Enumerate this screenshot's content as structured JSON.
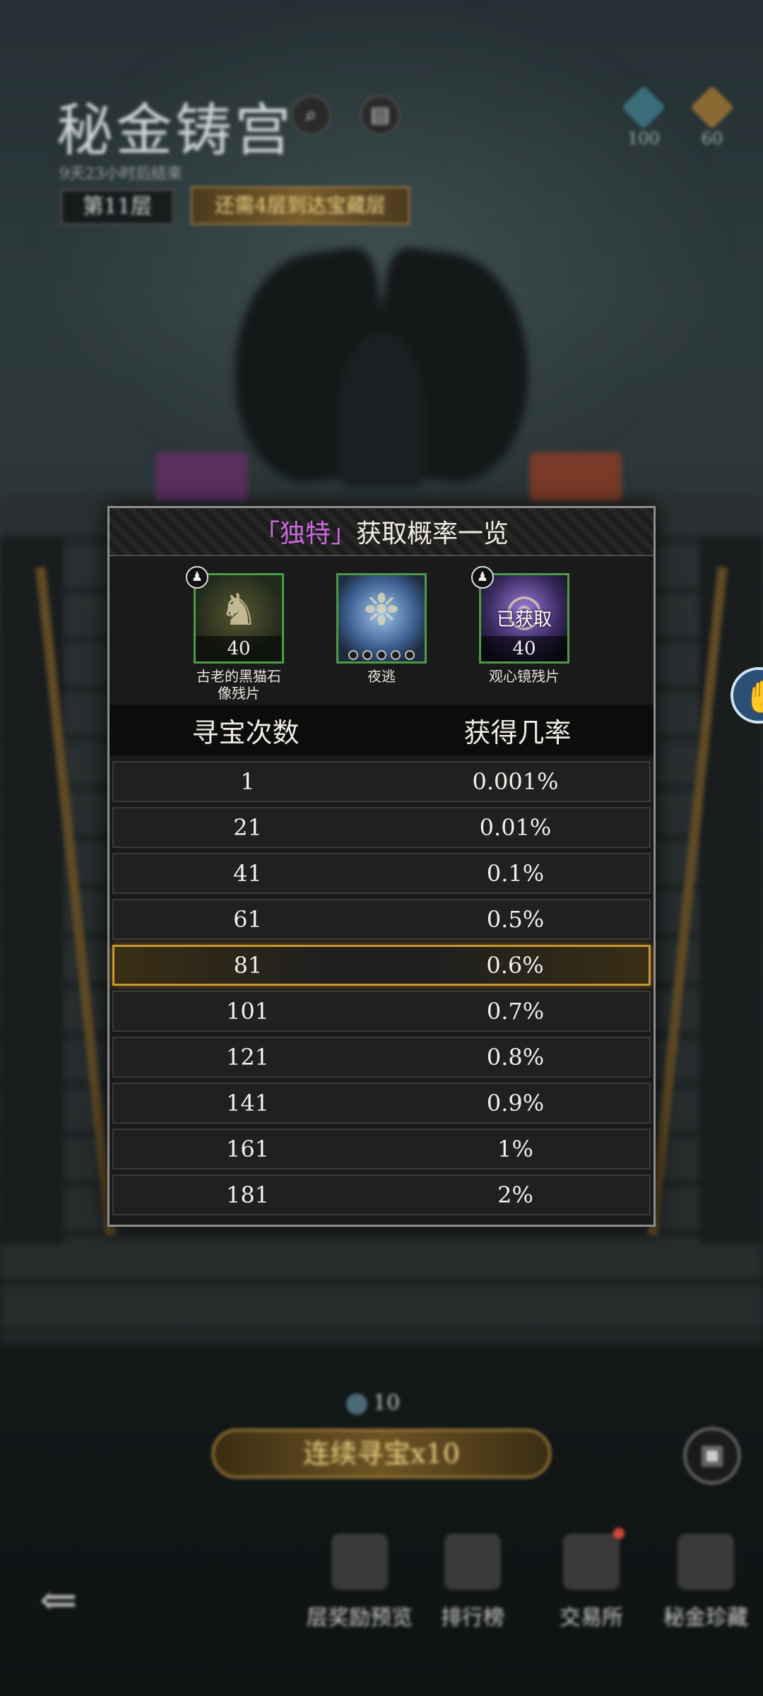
{
  "hud": {
    "title": "秘金铸宫",
    "subtitle": "9天23小时后结束",
    "floor": "第11层",
    "floor_tip": "还需4层到达宝藏层",
    "search_icon": "magnifier-icon",
    "book_icon": "book-icon",
    "resource_1": "100",
    "resource_2": "60"
  },
  "modal": {
    "title_open": "「",
    "title_highlight": "独特",
    "title_close": "」",
    "title_rest": "获取概率一览",
    "highlight_color": "#c86ad8",
    "items": [
      {
        "name": "古老的黑猫石像残片",
        "qty": "40",
        "icon": "cat-statue-icon"
      },
      {
        "name": "夜逃",
        "qty": "",
        "icon": "night-escape-icon"
      },
      {
        "name": "观心镜残片",
        "qty": "40",
        "status": "已获取",
        "icon": "mirror-icon"
      }
    ],
    "columns": [
      "寻宝次数",
      "获得几率"
    ],
    "rows": [
      [
        "1",
        "0.001%"
      ],
      [
        "21",
        "0.01%"
      ],
      [
        "41",
        "0.1%"
      ],
      [
        "61",
        "0.5%"
      ],
      [
        "81",
        "0.6%"
      ],
      [
        "101",
        "0.7%"
      ],
      [
        "121",
        "0.8%"
      ],
      [
        "141",
        "0.9%"
      ],
      [
        "161",
        "1%"
      ],
      [
        "181",
        "2%"
      ]
    ],
    "current_row_accent": "#c9962e"
  },
  "bottom": {
    "cost": "10",
    "cta_label": "连续寻宝x10",
    "nav": [
      {
        "label": "层奖励预览",
        "icon": "chest-preview-icon"
      },
      {
        "label": "排行榜",
        "icon": "trophy-icon"
      },
      {
        "label": "交易所",
        "icon": "exchange-icon"
      },
      {
        "label": "秘金珍藏",
        "icon": "treasure-icon"
      }
    ]
  }
}
